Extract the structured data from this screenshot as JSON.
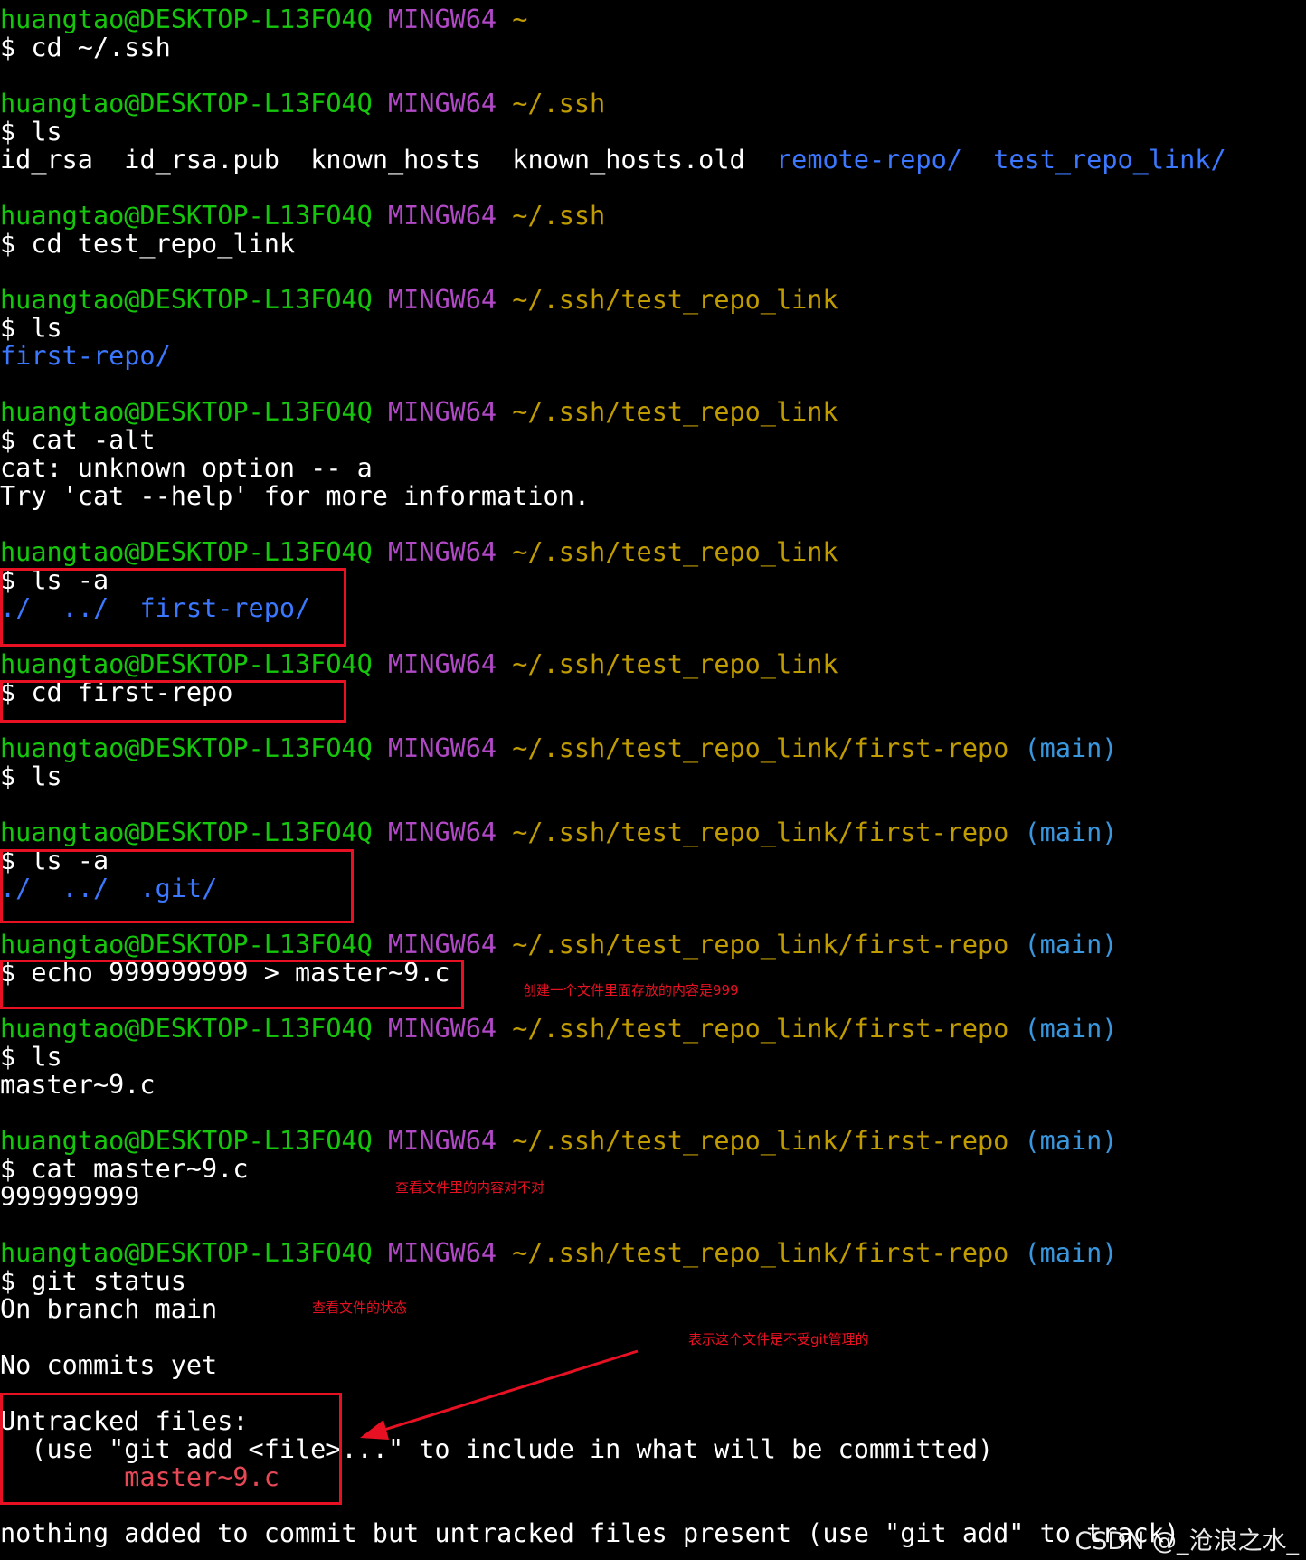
{
  "prompt": {
    "user_host": "huangtao@DESKTOP-L13FO4Q",
    "shell": "MINGW64",
    "branch": "(main)"
  },
  "paths": {
    "home": "~",
    "ssh": "~/.ssh",
    "link": "~/.ssh/test_repo_link",
    "repo": "~/.ssh/test_repo_link/first-repo"
  },
  "commands": {
    "c1": "$ cd ~/.ssh",
    "c2": "$ ls",
    "c3": "$ cd test_repo_link",
    "c4": "$ ls",
    "c5": "$ cat -alt",
    "c6": "$ ls -a",
    "c7": "$ cd first-repo",
    "c8": "$ ls",
    "c9": "$ ls -a",
    "c10": "$ echo 999999999 > master~9.c",
    "c11": "$ ls",
    "c12": "$ cat master~9.c",
    "c13": "$ git status"
  },
  "outputs": {
    "ssh_files": [
      "id_rsa",
      "id_rsa.pub",
      "known_hosts",
      "known_hosts.old"
    ],
    "ssh_dirs": [
      "remote-repo/",
      "test_repo_link/"
    ],
    "link_ls": "first-repo/",
    "cat_err1": "cat: unknown option -- a",
    "cat_err2": "Try 'cat --help' for more information.",
    "ls_a1_dots": "./  ../",
    "ls_a1_dir": "first-repo/",
    "ls_a2_dots": "./  ../",
    "ls_a2_dir": ".git/",
    "ls_file": "master~9.c",
    "cat_out": "999999999",
    "status1": "On branch main",
    "status2": "No commits yet",
    "status3": "Untracked files:",
    "status4": "  (use \"git add <file>...\" to include in what will be committed)",
    "status5": "master~9.c",
    "status6": "nothing added to commit but untracked files present (use \"git add\" to track)"
  },
  "annotations": {
    "note_echo": "创建一个文件里面存放的内容是999",
    "note_cat": "查看文件里的内容对不对",
    "note_status": "查看文件的状态",
    "note_untracked": "表示这个文件是不受git管理的"
  },
  "watermark": "CSDN @_沧浪之水_",
  "colors": {
    "background": "#000000",
    "user_host": "#16c60c",
    "shell": "#b148c6",
    "path": "#c19c00",
    "branch": "#3a96dd",
    "directory": "#3b78ff",
    "untracked": "#e74856",
    "annotation": "#e81123"
  }
}
